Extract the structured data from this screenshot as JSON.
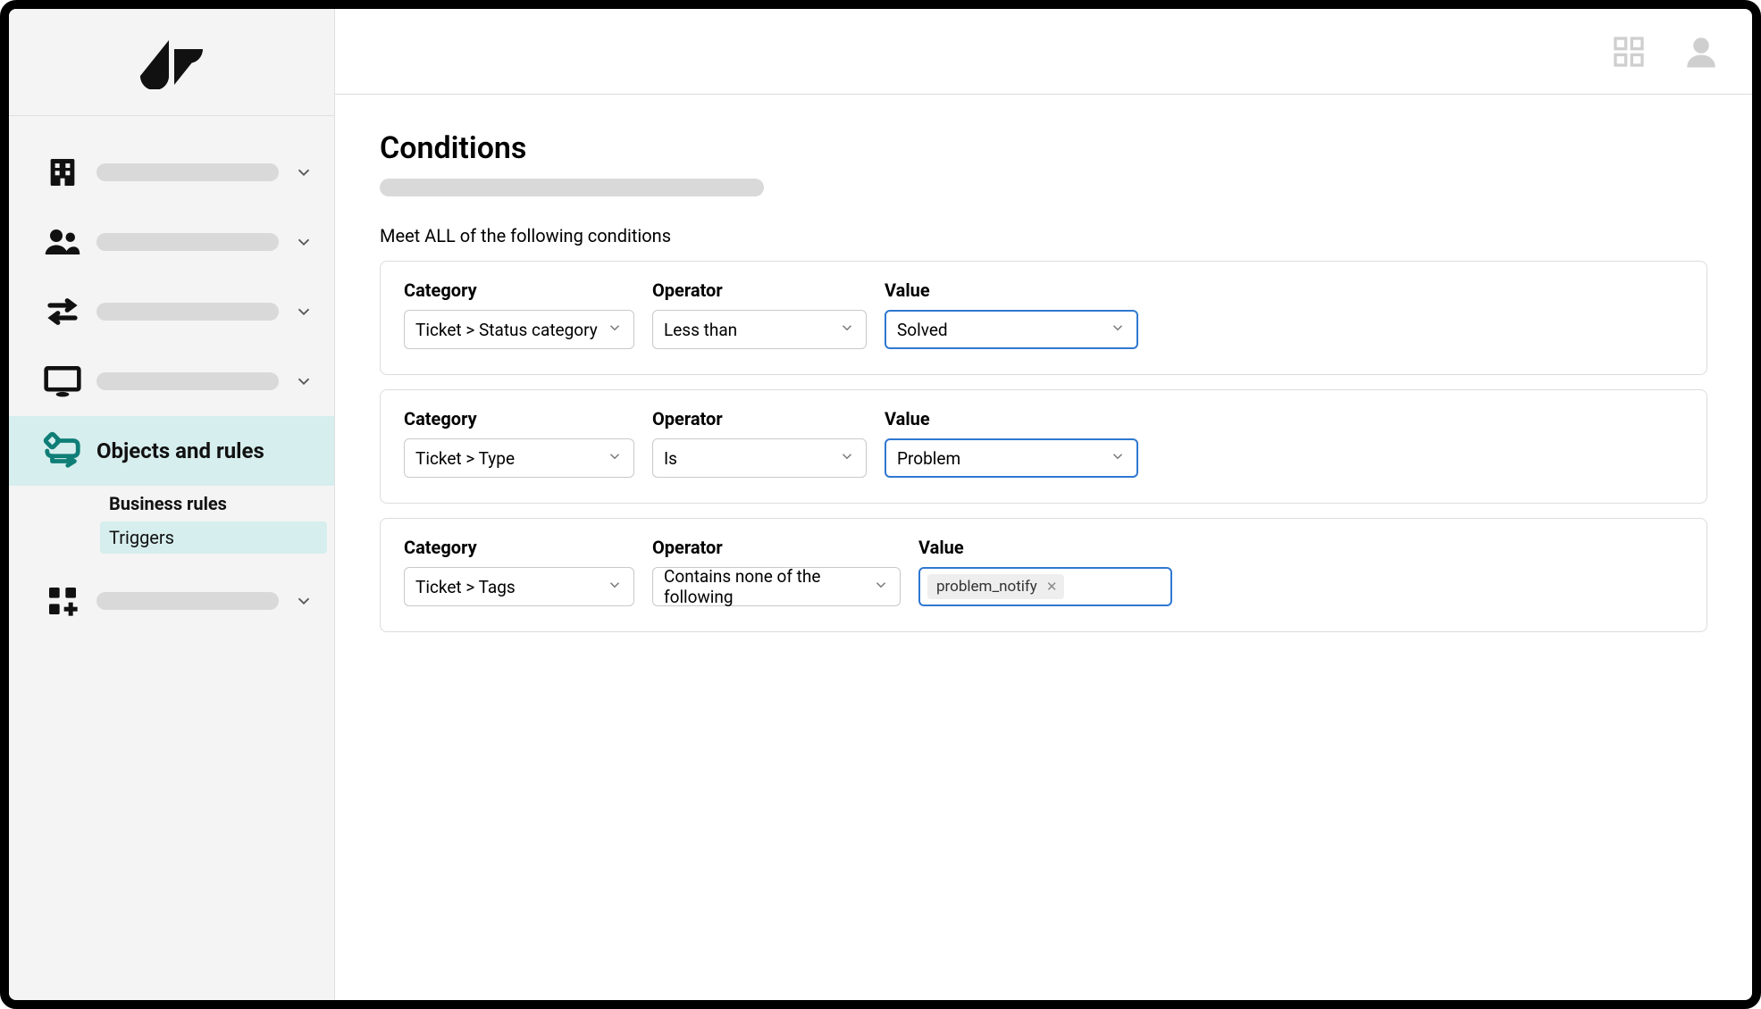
{
  "sidebar": {
    "objects_rules_label": "Objects and rules",
    "sub_business_rules": "Business rules",
    "sub_triggers": "Triggers"
  },
  "page": {
    "title": "Conditions",
    "section_all": "Meet ALL of the following conditions"
  },
  "labels": {
    "category": "Category",
    "operator": "Operator",
    "value": "Value"
  },
  "conditions": [
    {
      "category": "Ticket > Status category",
      "operator": "Less than",
      "value": "Solved"
    },
    {
      "category": "Ticket > Type",
      "operator": "Is",
      "value": "Problem"
    },
    {
      "category": "Ticket > Tags",
      "operator": "Contains none of the following",
      "tags": [
        "problem_notify"
      ]
    }
  ]
}
